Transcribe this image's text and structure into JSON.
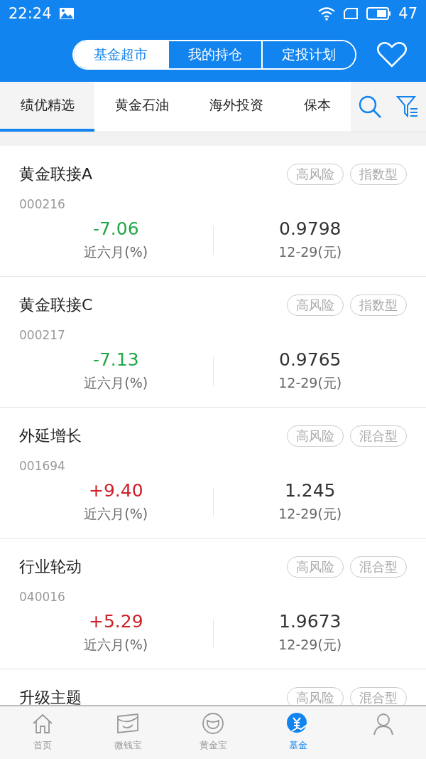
{
  "status_bar": {
    "time": "22:24",
    "battery": "47"
  },
  "segments": [
    {
      "label": "基金超市",
      "selected": true
    },
    {
      "label": "我的持仓",
      "selected": false
    },
    {
      "label": "定投计划",
      "selected": false
    }
  ],
  "category_tabs": [
    {
      "label": "绩优精选",
      "selected": true
    },
    {
      "label": "黄金石油",
      "selected": false
    },
    {
      "label": "海外投资",
      "selected": false
    },
    {
      "label": "保本",
      "selected": false
    }
  ],
  "funds": [
    {
      "name": "黄金联接A",
      "code": "000216",
      "tags": [
        "高风险",
        "指数型"
      ],
      "change": "-7.06",
      "color": "#1fa845",
      "change_label": "近六月(%)",
      "nav": "0.9798",
      "nav_label": "12-29(元)"
    },
    {
      "name": "黄金联接C",
      "code": "000217",
      "tags": [
        "高风险",
        "指数型"
      ],
      "change": "-7.13",
      "color": "#1fa845",
      "change_label": "近六月(%)",
      "nav": "0.9765",
      "nav_label": "12-29(元)"
    },
    {
      "name": "外延增长",
      "code": "001694",
      "tags": [
        "高风险",
        "混合型"
      ],
      "change": "+9.40",
      "color": "#d0202a",
      "change_label": "近六月(%)",
      "nav": "1.245",
      "nav_label": "12-29(元)"
    },
    {
      "name": "行业轮动",
      "code": "040016",
      "tags": [
        "高风险",
        "混合型"
      ],
      "change": "+5.29",
      "color": "#d0202a",
      "change_label": "近六月(%)",
      "nav": "1.9673",
      "nav_label": "12-29(元)"
    },
    {
      "name": "升级主题",
      "tags": [
        "高风险",
        "混合型"
      ]
    }
  ],
  "bottom_nav": [
    {
      "kind": "home",
      "label": "首页",
      "selected": false
    },
    {
      "kind": "wallet",
      "label": "微钱宝",
      "selected": false
    },
    {
      "kind": "gold",
      "label": "黄金宝",
      "selected": false
    },
    {
      "kind": "fund",
      "label": "基金",
      "selected": true
    },
    {
      "kind": "user",
      "selected": false
    }
  ]
}
